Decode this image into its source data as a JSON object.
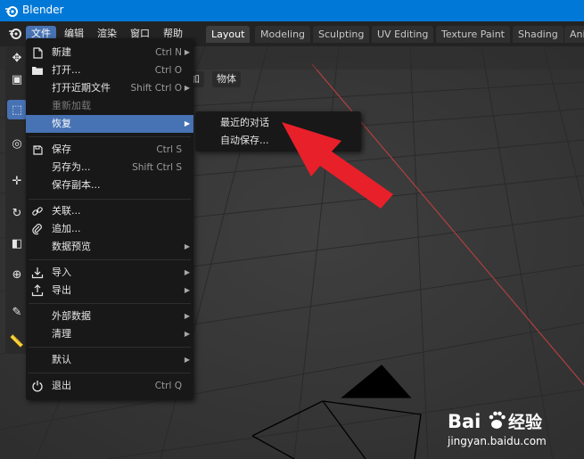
{
  "window": {
    "title": "Blender"
  },
  "menubar": {
    "items": [
      "文件",
      "编辑",
      "渲染",
      "窗口",
      "帮助"
    ],
    "active_index": 0
  },
  "workspace_tabs": [
    {
      "label": "Layout",
      "active": true
    },
    {
      "label": "Modeling"
    },
    {
      "label": "Sculpting"
    },
    {
      "label": "UV Editing"
    },
    {
      "label": "Texture Paint"
    },
    {
      "label": "Shading"
    },
    {
      "label": "Ani"
    }
  ],
  "viewport_header": {
    "add_partial": "加",
    "object": "物体"
  },
  "file_menu": {
    "items": [
      {
        "label": "新建",
        "shortcut": "Ctrl N",
        "icon": "new-file-icon",
        "arrow": true
      },
      {
        "label": "打开...",
        "shortcut": "Ctrl O",
        "icon": "folder-icon"
      },
      {
        "label": "打开近期文件",
        "shortcut": "Shift Ctrl O",
        "arrow": true
      },
      {
        "label": "重新加载",
        "disabled": true
      },
      {
        "label": "恢复",
        "highlighted": true,
        "arrow": true
      },
      {
        "separator": true
      },
      {
        "label": "保存",
        "shortcut": "Ctrl S",
        "icon": "save-icon"
      },
      {
        "label": "另存为...",
        "shortcut": "Shift Ctrl S"
      },
      {
        "label": "保存副本..."
      },
      {
        "separator": true
      },
      {
        "label": "关联...",
        "icon": "link-icon"
      },
      {
        "label": "追加...",
        "icon": "paperclip-icon"
      },
      {
        "label": "数据预览",
        "arrow": true
      },
      {
        "separator": true
      },
      {
        "label": "导入",
        "icon": "import-icon",
        "arrow": true
      },
      {
        "label": "导出",
        "icon": "export-icon",
        "arrow": true
      },
      {
        "separator": true
      },
      {
        "label": "外部数据",
        "arrow": true
      },
      {
        "label": "清理",
        "arrow": true
      },
      {
        "separator": true
      },
      {
        "label": "默认",
        "arrow": true
      },
      {
        "separator": true
      },
      {
        "label": "退出",
        "shortcut": "Ctrl Q",
        "icon": "power-icon"
      }
    ]
  },
  "recover_submenu": {
    "items": [
      "最近的对话",
      "自动保存..."
    ]
  },
  "watermark": {
    "brand": "Bai",
    "brand_suffix": "经验",
    "url": "jingyan.baidu.com"
  },
  "colors": {
    "titlebar": "#0078d7",
    "accent": "#4772b3",
    "arrow": "#e8202a"
  }
}
